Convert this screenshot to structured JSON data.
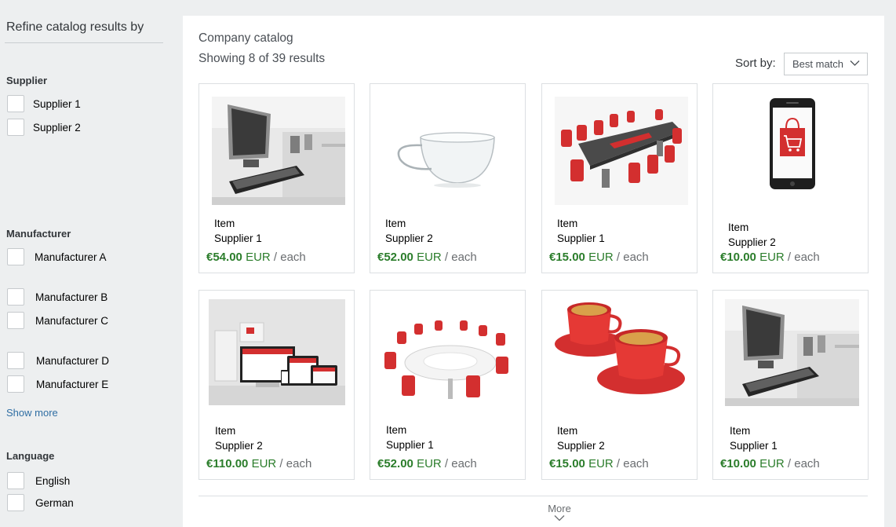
{
  "sidebar": {
    "title": "Refine catalog results by",
    "supplier_heading": "Supplier",
    "suppliers": [
      "Supplier 1",
      "Supplier 2"
    ],
    "manufacturer_heading": "Manufacturer",
    "manufacturers": [
      "Manufacturer A",
      "Manufacturer B",
      "Manufacturer C",
      "Manufacturer D",
      "Manufacturer E"
    ],
    "show_more": "Show more",
    "language_heading": "Language",
    "languages": [
      "English",
      "German"
    ]
  },
  "main": {
    "title": "Company catalog",
    "results": "Showing 8 of 39 results",
    "sort_label": "Sort by:",
    "sort_value": "Best match",
    "more_label": "More",
    "products": [
      {
        "image": "desktop-computer",
        "item": "Item",
        "supplier": "Supplier 1",
        "amount": "€54.00",
        "currency": "EUR",
        "unit": "/ each"
      },
      {
        "image": "glass-cup",
        "item": "Item",
        "supplier": "Supplier 2",
        "amount": "€52.00",
        "currency": "EUR",
        "unit": "/ each"
      },
      {
        "image": "conference-table-red-chairs",
        "item": "Item",
        "supplier": "Supplier 1",
        "amount": "€15.00",
        "currency": "EUR",
        "unit": "/ each"
      },
      {
        "image": "smartphone-shopping-bag",
        "item": "Item",
        "supplier": "Supplier 2",
        "amount": "€10.00",
        "currency": "EUR",
        "unit": "/ each"
      },
      {
        "image": "devices-website",
        "item": "Item",
        "supplier": "Supplier 2",
        "amount": "€110.00",
        "currency": "EUR",
        "unit": "/ each"
      },
      {
        "image": "round-table-red-chairs",
        "item": "Item",
        "supplier": "Supplier 1",
        "amount": "€52.00",
        "currency": "EUR",
        "unit": "/ each"
      },
      {
        "image": "red-coffee-cups",
        "item": "Item",
        "supplier": "Supplier 2",
        "amount": "€15.00",
        "currency": "EUR",
        "unit": "/ each"
      },
      {
        "image": "desktop-computer",
        "item": "Item",
        "supplier": "Supplier 1",
        "amount": "€10.00",
        "currency": "EUR",
        "unit": "/ each"
      }
    ]
  },
  "colors": {
    "price_green": "#2b7d2b",
    "background": "#edeff0",
    "link_blue": "#2f6ea3",
    "accent_red": "#d32f2f"
  }
}
